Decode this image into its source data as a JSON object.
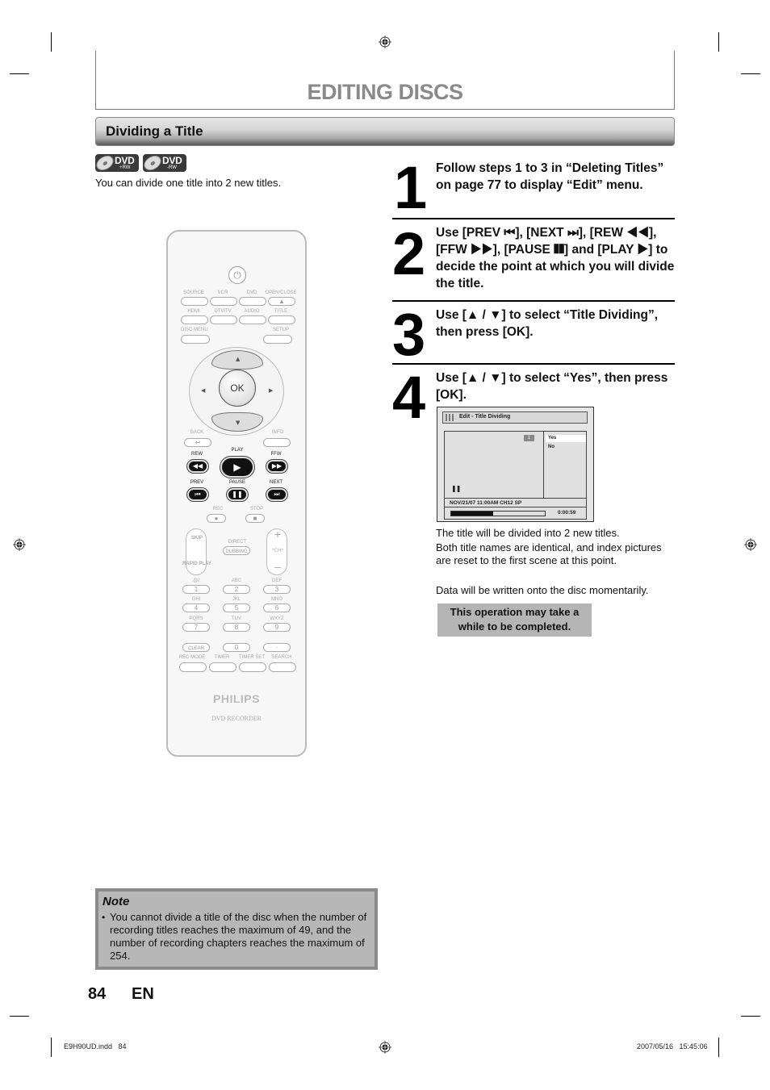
{
  "header": {
    "title": "EDITING DISCS"
  },
  "section": {
    "title": "Dividing a Title"
  },
  "disc_badges": [
    {
      "icon": "dvd-plus-rw-icon",
      "label": "DVD",
      "sub": "+RW"
    },
    {
      "icon": "dvd-minus-rw-icon",
      "label": "DVD",
      "sub": "-RW"
    }
  ],
  "intro": "You can divide one title into 2 new titles.",
  "remote": {
    "row1": [
      "SOURCE",
      "VCR",
      "DVD",
      "OPEN/CLOSE"
    ],
    "row2": [
      "HDMI",
      "DTV/TV",
      "AUDIO",
      "TITLE"
    ],
    "disc_menu": "DISC MENU",
    "setup": "SETUP",
    "ok": "OK",
    "back": "BACK",
    "info": "INFO",
    "transport_labels": {
      "rew": "REW",
      "play": "PLAY",
      "ffw": "FFW",
      "prev": "PREV",
      "pause": "PAUSE",
      "next": "NEXT",
      "rec": "REC",
      "stop": "STOP"
    },
    "skip": "SKIP",
    "rapid_play": "RAPID PLAY",
    "direct": "DIRECT",
    "dubbing": "DUBBING",
    "ch": "*CH*",
    "keypad": [
      {
        "letters": ".@/:",
        "digit": "1"
      },
      {
        "letters": "ABC",
        "digit": "2"
      },
      {
        "letters": "DEF",
        "digit": "3"
      },
      {
        "letters": "GHI",
        "digit": "4"
      },
      {
        "letters": "JKL",
        "digit": "5"
      },
      {
        "letters": "MNO",
        "digit": "6"
      },
      {
        "letters": "PQRS",
        "digit": "7"
      },
      {
        "letters": "TUV",
        "digit": "8"
      },
      {
        "letters": "WXYZ",
        "digit": "9"
      }
    ],
    "clear": "CLEAR",
    "zero": "0",
    "dot": "·",
    "bottom_row": [
      "REC MODE",
      "TIMER",
      "TIMER SET",
      "SEARCH"
    ],
    "brand": "PHILIPS",
    "model": "DVD RECORDER"
  },
  "steps": [
    {
      "num": "1",
      "text": "Follow steps 1 to 3 in “Deleting Titles” on page 77 to display “Edit” menu."
    },
    {
      "num": "2",
      "text": "Use [PREV ⏮], [NEXT ⏭], [REW ◀◀], [FFW ▶▶], [PAUSE ❚❚] and [PLAY ▶] to decide the point at which you will divide the title."
    },
    {
      "num": "3",
      "text": "Use [▲ / ▼] to select “Title Dividing”, then press [OK]."
    },
    {
      "num": "4",
      "text": "Use [▲ / ▼] to select “Yes”, then press [OK]."
    }
  ],
  "osd": {
    "title": "Edit - Title Dividing",
    "title_number": "1",
    "options": [
      "Yes",
      "No"
    ],
    "selected": "Yes",
    "pause_symbol": "❚❚",
    "info": "NOV/21/07 11:00AM CH12 SP",
    "progress_percent": 45,
    "time": "0:00:59"
  },
  "result_text": {
    "line1": "The title will be divided into 2 new titles.",
    "line2": "Both title names are identical, and index pictures are reset to the first scene at this point.",
    "line3": "Data will be written onto the disc momentarily."
  },
  "callout": "This operation may take a while to be completed.",
  "note": {
    "title": "Note",
    "bullet": "•",
    "text": "You cannot divide a title of the disc when the number of recording titles reaches the maximum of 49, and the number of recording chapters reaches the maximum of 254."
  },
  "footer": {
    "page_number": "84",
    "language": "EN",
    "file": "E9H90UD.indd   84",
    "timestamp": "2007/05/16   15:45:06"
  }
}
